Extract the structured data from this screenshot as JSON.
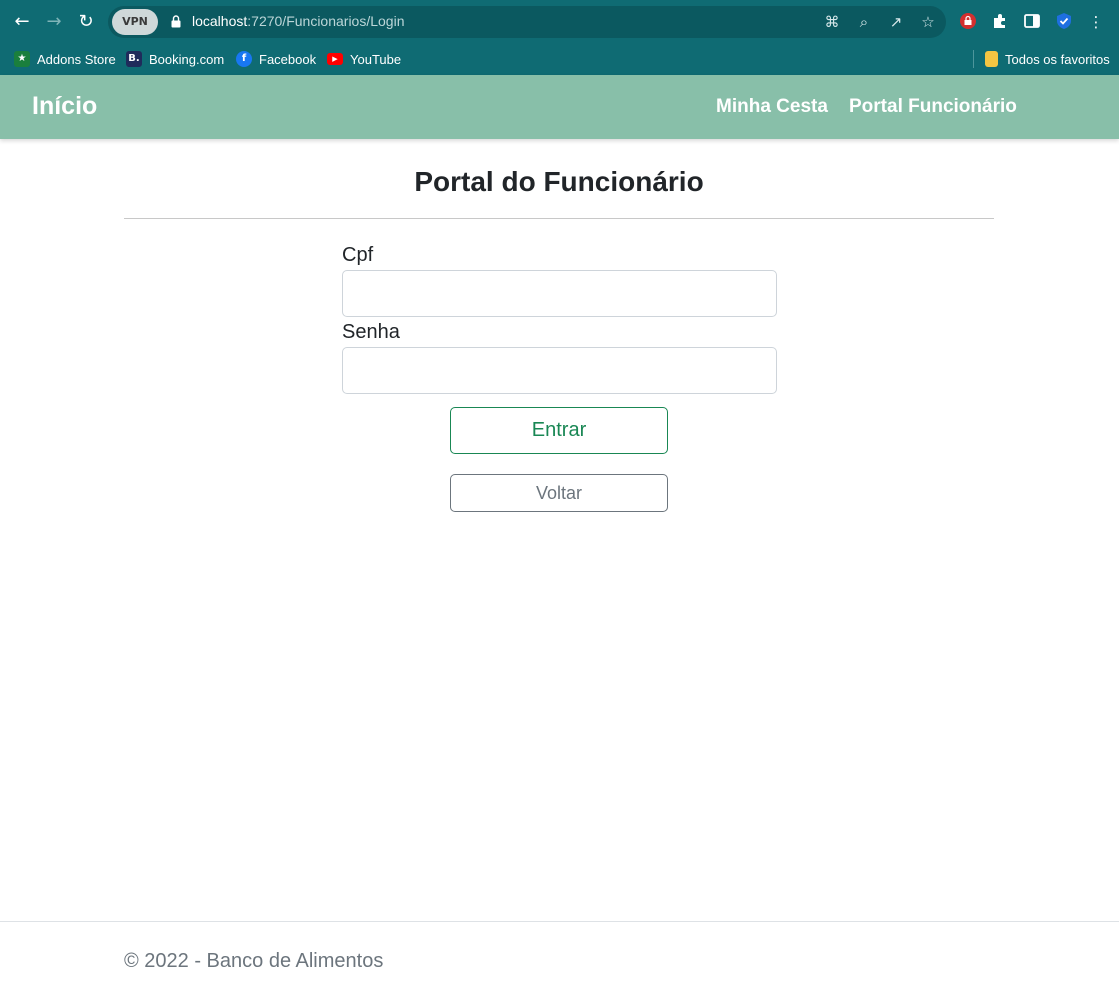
{
  "browser": {
    "url_host": "localhost",
    "url_rest": ":7270/Funcionarios/Login",
    "vpn_label": "VPN",
    "bookmarks": [
      {
        "label": "Addons Store",
        "icon": "addons-icon",
        "color": "#1a7f3c"
      },
      {
        "label": "Booking.com",
        "icon": "booking-icon",
        "color": "#1f2b5b"
      },
      {
        "label": "Facebook",
        "icon": "facebook-icon",
        "color": "#1877f2"
      },
      {
        "label": "YouTube",
        "icon": "youtube-icon",
        "color": "#ff0000"
      }
    ],
    "favorites_label": "Todos os favoritos",
    "theme_color": "#0f6b73"
  },
  "navbar": {
    "brand": "Início",
    "links": [
      "Minha Cesta",
      "Portal Funcionário"
    ],
    "color": "#88bfa9"
  },
  "login": {
    "title": "Portal do Funcionário",
    "cpf_label": "Cpf",
    "cpf_value": "",
    "senha_label": "Senha",
    "senha_value": "",
    "submit_label": "Entrar",
    "back_label": "Voltar"
  },
  "footer": {
    "text": "© 2022 - Banco de Alimentos"
  }
}
